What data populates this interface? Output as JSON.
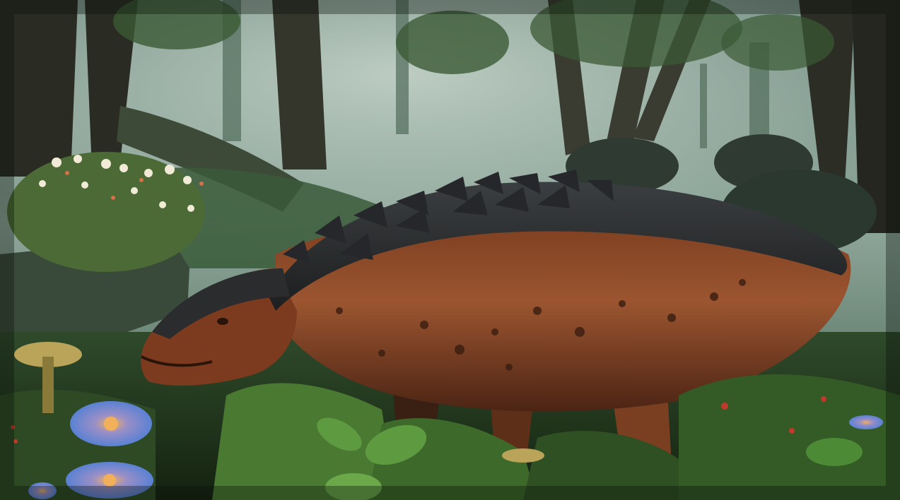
{
  "scene": {
    "palette": {
      "fog": "#9fb3a6",
      "canopy": "#2e4a2c",
      "trunk": "#2a2a22",
      "armor": "#2b2d2e",
      "hide": "#8a4a26",
      "hide_dark": "#5a2c18",
      "grass": "#3f6e2e",
      "flower_petal": "#6f8fd0",
      "flower_center": "#e4a04f"
    }
  }
}
